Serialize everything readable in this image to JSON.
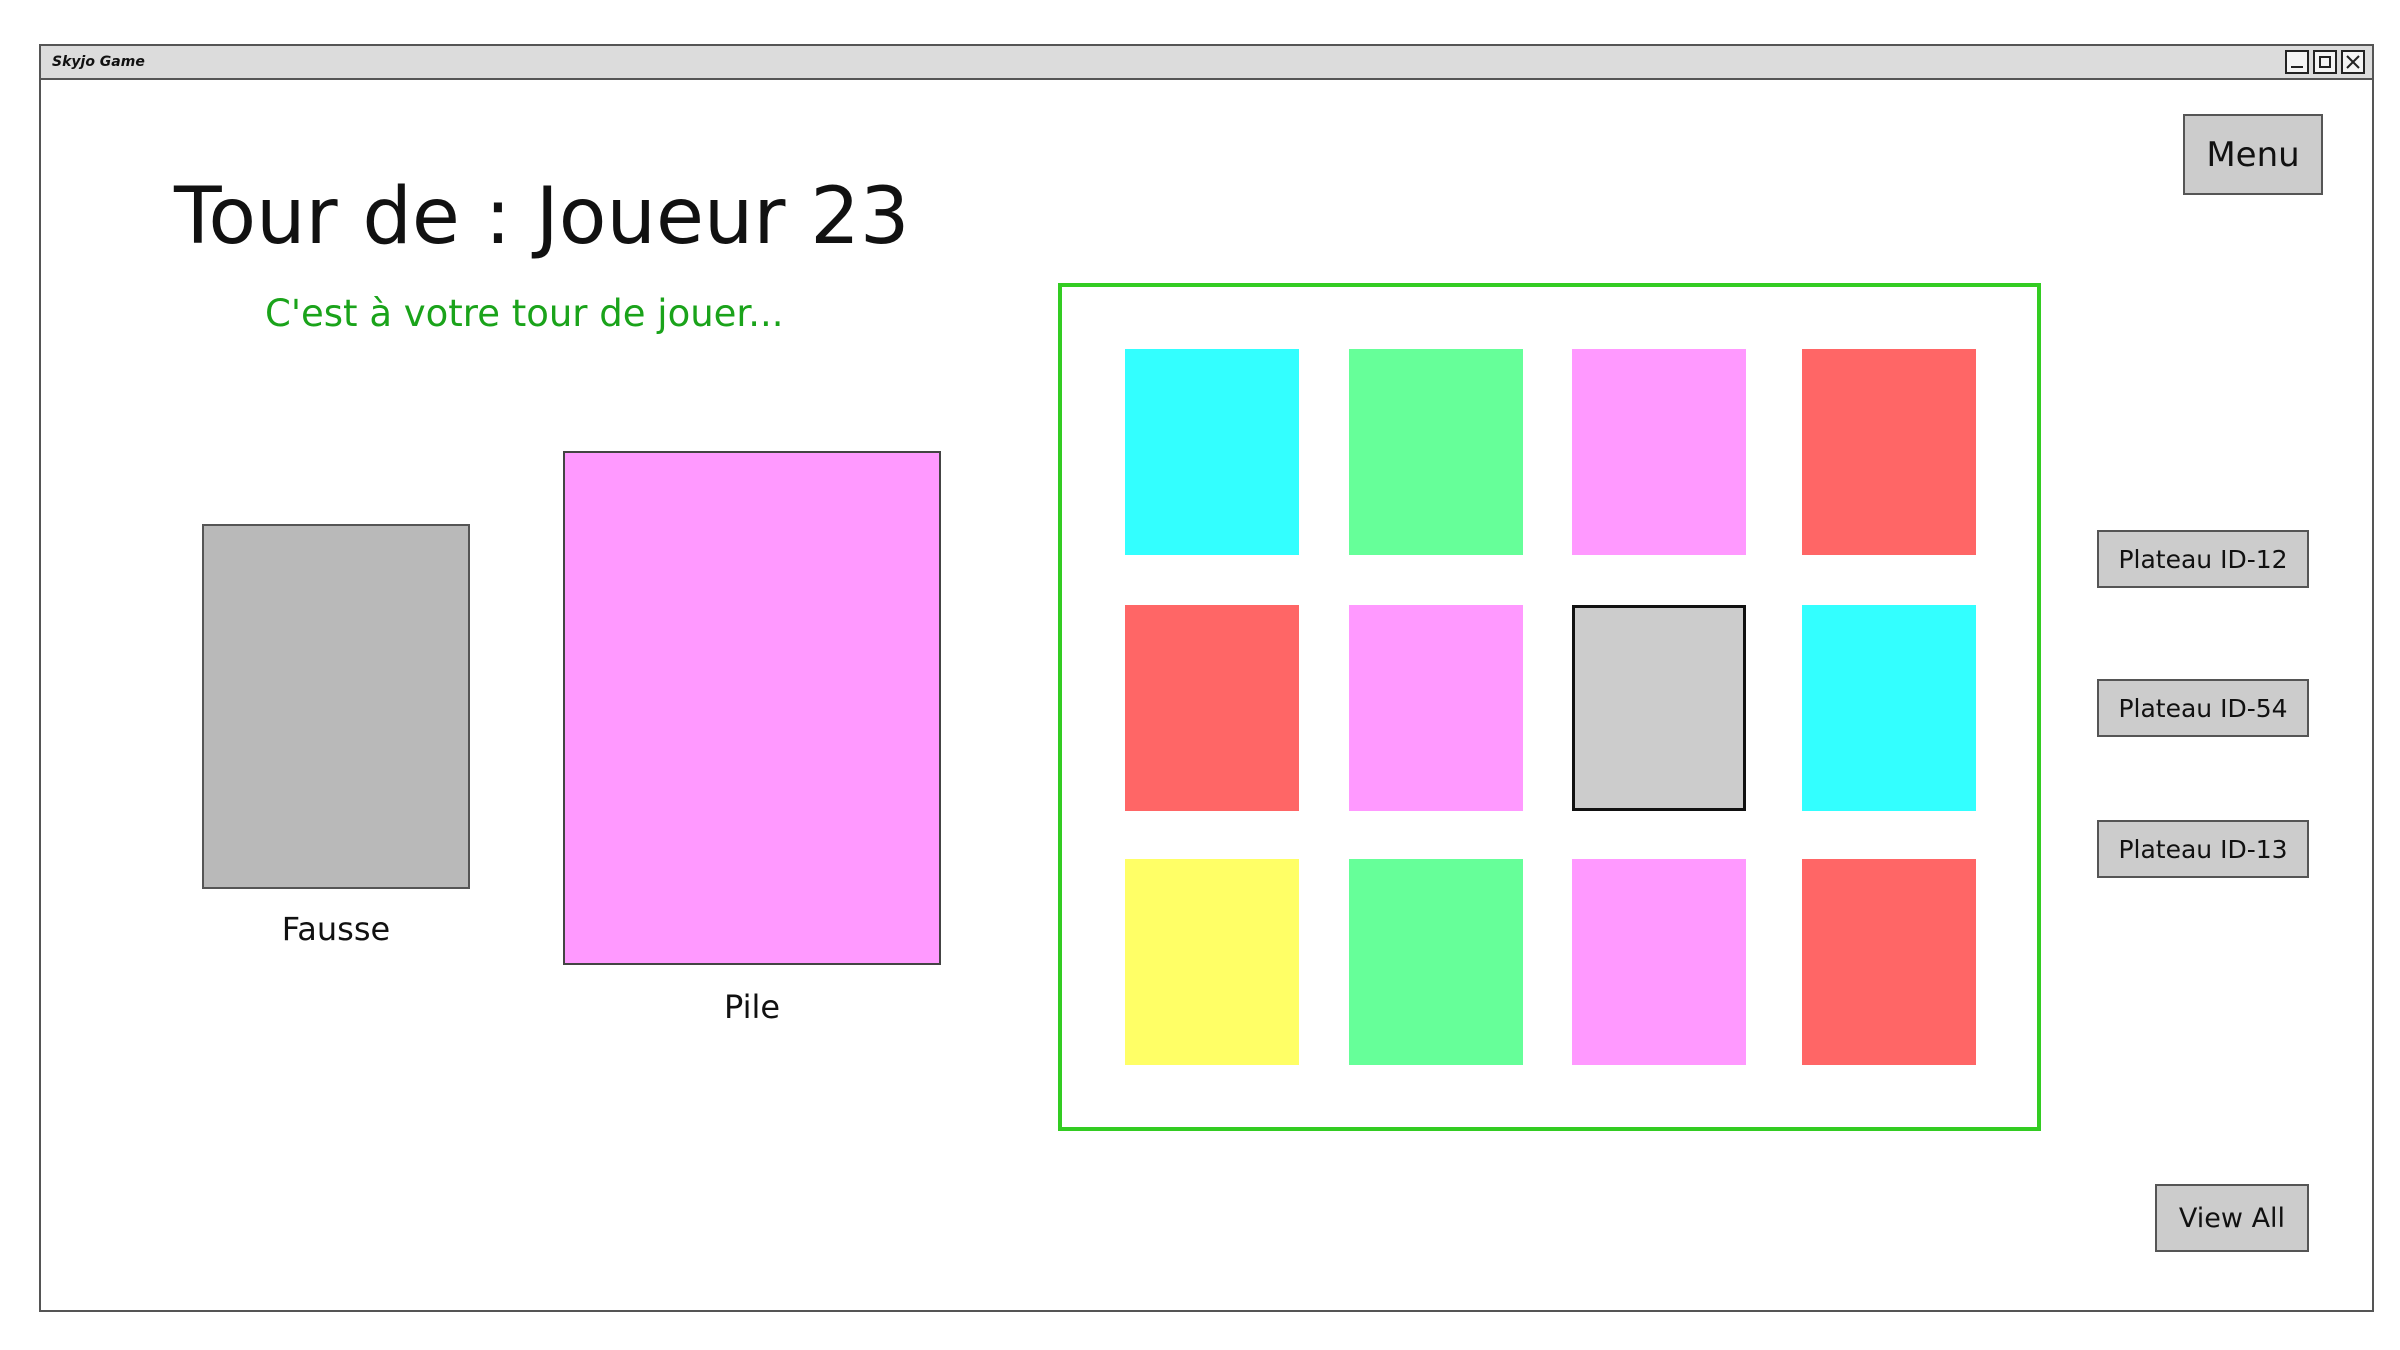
{
  "window": {
    "title": "Skyjo Game"
  },
  "header": {
    "menu_label": "Menu",
    "turn_title": "Tour de : Joueur 23",
    "turn_subtitle": "C'est à votre tour de jouer..."
  },
  "piles": {
    "discard_label": "Fausse",
    "draw_label": "Pile"
  },
  "board": {
    "border_color": "#33cc22",
    "cards": [
      {
        "color": "#33ffff"
      },
      {
        "color": "#66ff99"
      },
      {
        "color": "#ff99ff"
      },
      {
        "color": "#ff6666"
      },
      {
        "color": "#ff6666"
      },
      {
        "color": "#ff99ff"
      },
      {
        "color": "#cccccc",
        "selected": true
      },
      {
        "color": "#33ffff"
      },
      {
        "color": "#ffff66"
      },
      {
        "color": "#66ff99"
      },
      {
        "color": "#ff99ff"
      },
      {
        "color": "#ff6666"
      }
    ]
  },
  "side_panel": {
    "boards": [
      {
        "label": "Plateau ID-12"
      },
      {
        "label": "Plateau ID-54"
      },
      {
        "label": "Plateau ID-13"
      }
    ],
    "view_all_label": "View All"
  }
}
